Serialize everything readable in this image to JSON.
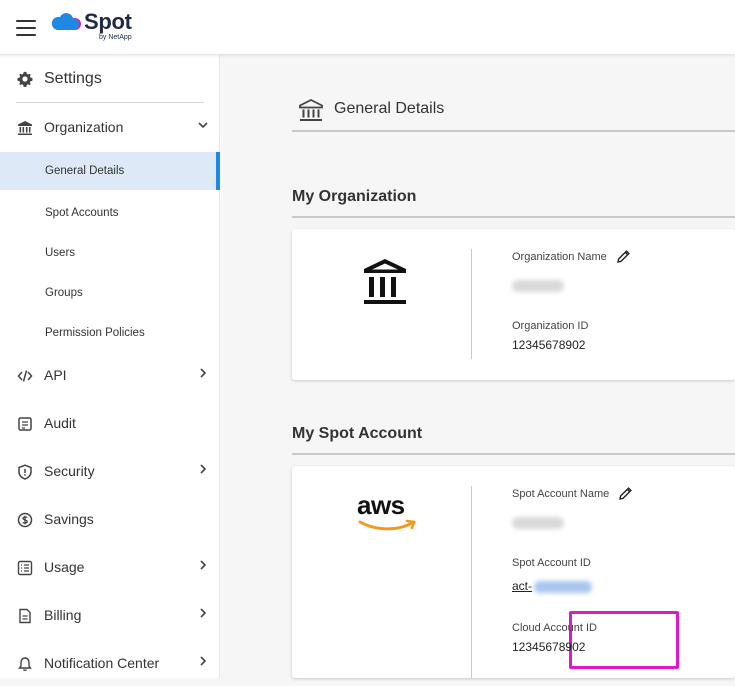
{
  "app": {
    "logo_text": "Spot",
    "logo_sub": "by NetApp",
    "colors": {
      "brand_blue": "#1e88e5",
      "brand_pink": "#e5219b",
      "active_bg": "#dde9f7",
      "highlight": "#e019c8",
      "aws_orange": "#f29b1b"
    }
  },
  "sidebar": {
    "settings_label": "Settings",
    "organization": {
      "label": "Organization",
      "sub_items": [
        {
          "label": "General Details",
          "active": true
        },
        {
          "label": "Spot Accounts"
        },
        {
          "label": "Users"
        },
        {
          "label": "Groups"
        },
        {
          "label": "Permission Policies"
        }
      ]
    },
    "items": [
      {
        "label": "API",
        "icon": "code-icon",
        "has_chevron": true
      },
      {
        "label": "Audit",
        "icon": "document-icon",
        "has_chevron": false
      },
      {
        "label": "Security",
        "icon": "shield-icon",
        "has_chevron": true
      },
      {
        "label": "Savings",
        "icon": "dollar-icon",
        "has_chevron": false
      },
      {
        "label": "Usage",
        "icon": "list-icon",
        "has_chevron": true
      },
      {
        "label": "Billing",
        "icon": "file-icon",
        "has_chevron": true
      },
      {
        "label": "Notification Center",
        "icon": "bell-icon",
        "has_chevron": true
      }
    ]
  },
  "main": {
    "page_title": "General Details",
    "my_organization": {
      "title": "My Organization",
      "org_name_label": "Organization Name",
      "org_id_label": "Organization ID",
      "org_id_value": "12345678902"
    },
    "my_spot_account": {
      "title": "My Spot Account",
      "logo_text": "aws",
      "account_name_label": "Spot Account Name",
      "account_id_label": "Spot Account ID",
      "account_id_prefix": "act-",
      "cloud_account_id_label": "Cloud Account ID",
      "cloud_account_id_value": "12345678902"
    }
  }
}
